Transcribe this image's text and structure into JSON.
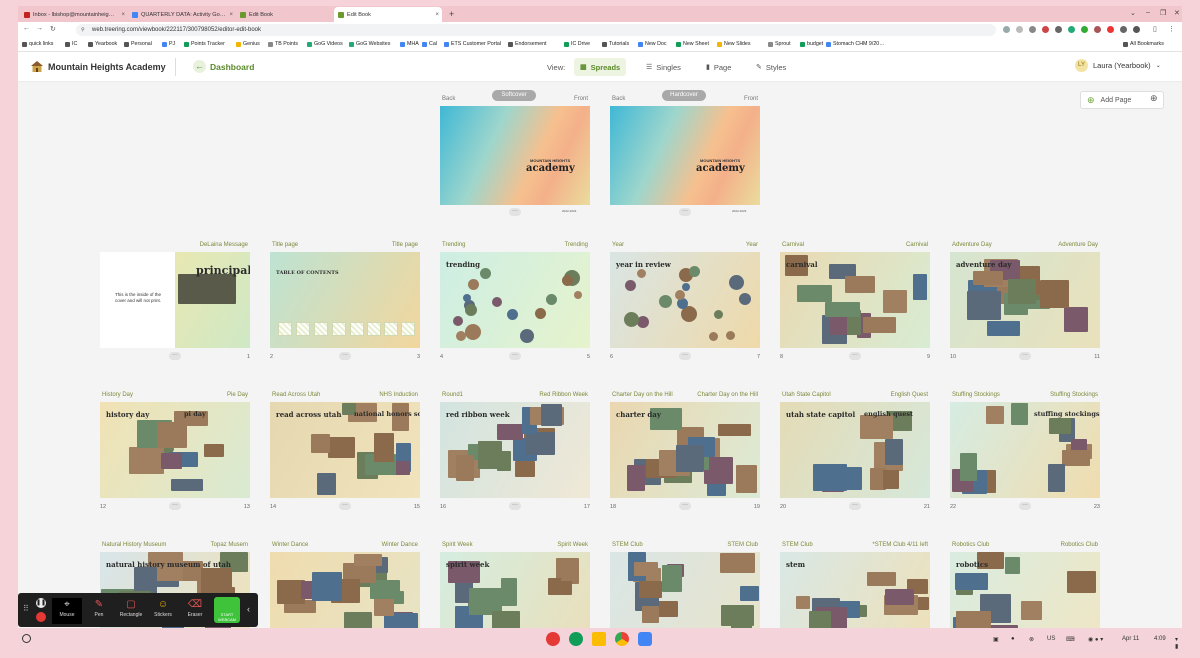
{
  "browser": {
    "tabs": [
      {
        "title": "Inbox - lbishop@mountainheig…",
        "favicon_color": "#c5221f"
      },
      {
        "title": "QUARTERLY DATA: Activity Go…",
        "favicon_color": "#4285f4"
      },
      {
        "title": "Edit Book",
        "favicon_color": "#6a9a2e"
      },
      {
        "title": "Edit Book",
        "favicon_color": "#6a9a2e"
      }
    ],
    "new_tab": "+",
    "url": "web.treering.com/viewbook/222117/300798052/editor-edit-book",
    "bookmarks": [
      "quick links",
      "IC",
      "Yearbook",
      "Personal",
      "PJ",
      "Points Tracker",
      "Genius",
      "TB Points",
      "GoG Videos",
      "GoG Websites",
      "MHA",
      "Cal",
      "ETS Customer Portal",
      "Endorsement",
      "IC Drive",
      "Tutorials",
      "New Doc",
      "New Sheet",
      "New Slides",
      "Sprout",
      "budget",
      "Stomach CHM 9/20…"
    ],
    "all_bookmarks": "All Bookmarks"
  },
  "header": {
    "school": "Mountain Heights Academy",
    "dashboard": "Dashboard",
    "view_label": "View:",
    "views": [
      "Spreads",
      "Singles",
      "Page",
      "Styles"
    ],
    "active_view": "Spreads",
    "user": "Laura (Yearbook)",
    "user_initial": "LY"
  },
  "actions": {
    "add_page": "Add Page"
  },
  "covers": [
    {
      "type": "Softcover",
      "back": "Back",
      "front": "Front",
      "small": "MOUNTAIN HEIGHTS",
      "title": "academy",
      "years": "2022-2023"
    },
    {
      "type": "Hardcover",
      "back": "Back",
      "front": "Front",
      "small": "MOUNTAIN HEIGHTS",
      "title": "academy",
      "years": "2022-2023"
    }
  ],
  "inside_cover_text": "This is the inside of the cover and will not print.",
  "spreads": [
    {
      "left": "",
      "right": "DeLaina Message",
      "ln": "",
      "rn": "1",
      "lt": "",
      "rt": "principal"
    },
    {
      "left": "Title page",
      "right": "Title page",
      "ln": "2",
      "rn": "3",
      "lt": "TABLE OF CONTENTS",
      "rt": ""
    },
    {
      "left": "Trending",
      "right": "Trending",
      "ln": "4",
      "rn": "5",
      "lt": "trending",
      "rt": ""
    },
    {
      "left": "Year",
      "right": "Year",
      "ln": "6",
      "rn": "7",
      "lt": "year in review",
      "rt": ""
    },
    {
      "left": "Carnival",
      "right": "Carnival",
      "ln": "8",
      "rn": "9",
      "lt": "carnival",
      "rt": ""
    },
    {
      "left": "Adventure Day",
      "right": "Adventure Day",
      "ln": "10",
      "rn": "11",
      "lt": "adventure day",
      "rt": ""
    },
    {
      "left": "History Day",
      "right": "Pie Day",
      "ln": "12",
      "rn": "13",
      "lt": "history day",
      "rt": "pi day"
    },
    {
      "left": "Read Across Utah",
      "right": "NHS Induction",
      "ln": "14",
      "rn": "15",
      "lt": "read across utah",
      "rt": "national honors society"
    },
    {
      "left": "Round1",
      "right": "Red Ribbon Week",
      "ln": "16",
      "rn": "17",
      "lt": "red ribbon week",
      "rt": ""
    },
    {
      "left": "Charter Day on the Hill",
      "right": "Charter Day on the Hill",
      "ln": "18",
      "rn": "19",
      "lt": "charter day",
      "rt": ""
    },
    {
      "left": "Utah State Capitol",
      "right": "English Quest",
      "ln": "20",
      "rn": "21",
      "lt": "utah state capitol",
      "rt": "english quest"
    },
    {
      "left": "Stuffing Stockings",
      "right": "Stuffing Stockings",
      "ln": "22",
      "rn": "23",
      "lt": "",
      "rt": "stuffing stockings"
    },
    {
      "left": "Natural History Museum",
      "right": "Topaz Musem",
      "ln": "",
      "rn": "",
      "lt": "natural history museum of utah",
      "rt": ""
    },
    {
      "left": "Winter Dance",
      "right": "Winter Dance",
      "ln": "",
      "rn": "",
      "lt": "",
      "rt": ""
    },
    {
      "left": "Spirit Week",
      "right": "Spirit Week",
      "ln": "",
      "rn": "",
      "lt": "spirit week",
      "rt": ""
    },
    {
      "left": "STEM Club",
      "right": "STEM Club",
      "ln": "",
      "rn": "",
      "lt": "",
      "rt": ""
    },
    {
      "left": "STEM Club",
      "right": "*STEM Club 4/11 left",
      "ln": "",
      "rn": "",
      "lt": "stem",
      "rt": ""
    },
    {
      "left": "Robotics Club",
      "right": "Robotics Club",
      "ln": "",
      "rn": "",
      "lt": "robotics",
      "rt": ""
    }
  ],
  "recorder": {
    "tools": [
      "Mouse",
      "Pen",
      "Rectangle",
      "Stickers",
      "Eraser"
    ],
    "start": "START WEBCAM"
  },
  "shelf": {
    "lang": "US",
    "date": "Apr 11",
    "time": "4:09"
  },
  "colors": {
    "accent": "#5a8a2a",
    "label": "#7a8a3a"
  }
}
